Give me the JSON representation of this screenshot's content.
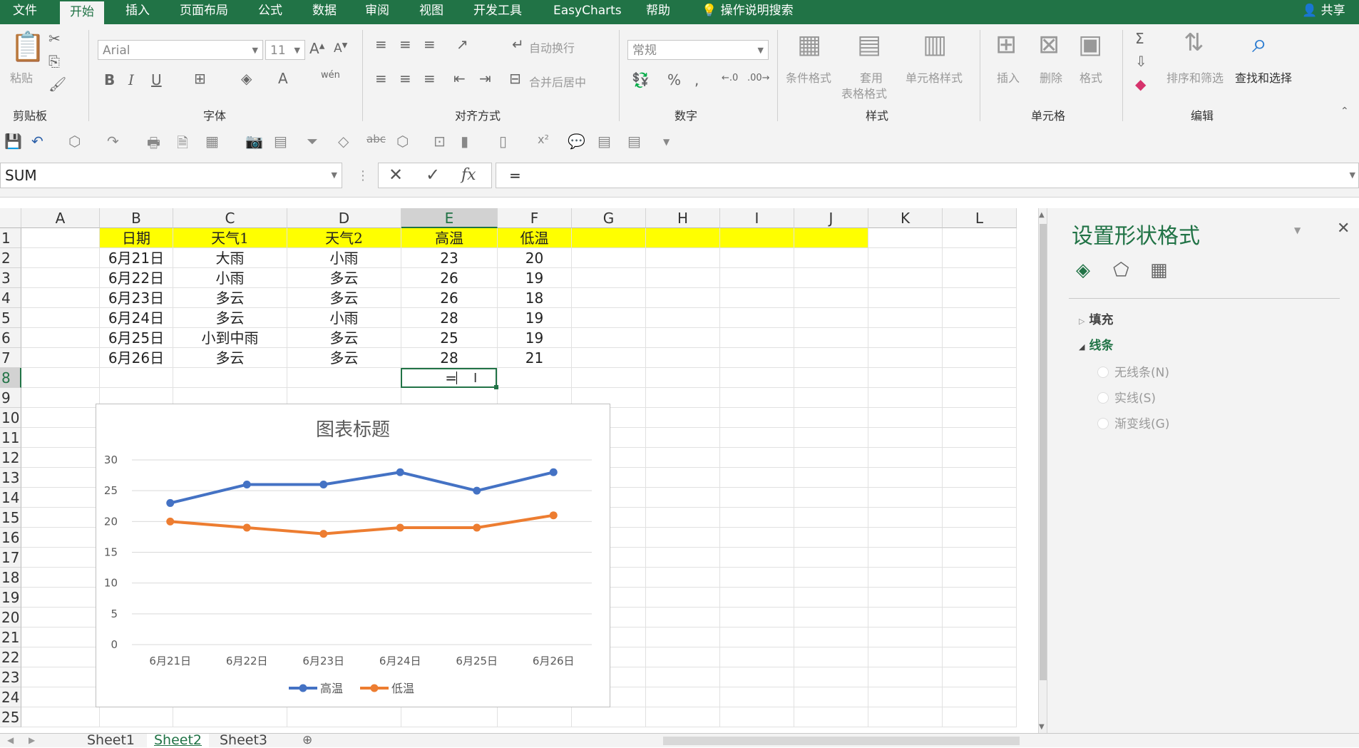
{
  "tabs": [
    "文件",
    "开始",
    "插入",
    "页面布局",
    "公式",
    "数据",
    "审阅",
    "视图",
    "开发工具",
    "EasyCharts",
    "帮助"
  ],
  "active_tab": "开始",
  "search_label": "操作说明搜索",
  "share_label": "共享",
  "ribbon": {
    "clipboard": {
      "paste": "粘贴",
      "group": "剪贴板"
    },
    "font": {
      "name": "Arial",
      "size": "11",
      "group": "字体",
      "phonetic": "wén"
    },
    "align": {
      "wrap": "自动换行",
      "merge": "合并后居中",
      "group": "对齐方式"
    },
    "number": {
      "format": "常规",
      "group": "数字"
    },
    "styles": {
      "cond": "条件格式",
      "table_1": "套用",
      "table_2": "表格格式",
      "cell": "单元格样式",
      "group": "样式"
    },
    "cells": {
      "insert": "插入",
      "delete": "删除",
      "format": "格式",
      "group": "单元格"
    },
    "edit": {
      "sort": "排序和筛选",
      "find": "查找和选择",
      "group": "编辑"
    }
  },
  "name_box": "SUM",
  "formula": "=",
  "columns": [
    "A",
    "B",
    "C",
    "D",
    "E",
    "F",
    "G",
    "H",
    "I",
    "J",
    "K",
    "L"
  ],
  "selected_column": "E",
  "rows": [
    "1",
    "2",
    "3",
    "4",
    "5",
    "6",
    "7",
    "8",
    "9",
    "10",
    "11",
    "12",
    "13",
    "14",
    "15",
    "16",
    "17",
    "18",
    "19",
    "20",
    "21",
    "22",
    "23",
    "24",
    "25"
  ],
  "selected_row": "8",
  "table": {
    "headers": [
      "日期",
      "天气1",
      "天气2",
      "高温",
      "低温"
    ],
    "data": [
      [
        "6月21日",
        "大雨",
        "小雨",
        "23",
        "20"
      ],
      [
        "6月22日",
        "小雨",
        "多云",
        "26",
        "19"
      ],
      [
        "6月23日",
        "多云",
        "多云",
        "26",
        "18"
      ],
      [
        "6月24日",
        "多云",
        "小雨",
        "28",
        "19"
      ],
      [
        "6月25日",
        "小到中雨",
        "多云",
        "25",
        "19"
      ],
      [
        "6月26日",
        "多云",
        "多云",
        "28",
        "21"
      ]
    ],
    "editing_value": "="
  },
  "header_fill": "#ffff00",
  "chart_data": {
    "type": "line",
    "title": "图表标题",
    "categories": [
      "6月21日",
      "6月22日",
      "6月23日",
      "6月24日",
      "6月25日",
      "6月26日"
    ],
    "series": [
      {
        "name": "高温",
        "values": [
          23,
          26,
          26,
          28,
          25,
          28
        ],
        "color": "#4472c4"
      },
      {
        "name": "低温",
        "values": [
          20,
          19,
          18,
          19,
          19,
          21
        ],
        "color": "#ed7d31"
      }
    ],
    "ylim": [
      0,
      30
    ],
    "yticks": [
      "0",
      "5",
      "10",
      "15",
      "20",
      "25",
      "30"
    ],
    "grid": true,
    "legend": "bottom"
  },
  "pane": {
    "title": "设置形状格式",
    "fill": "填充",
    "line": "线条",
    "options": [
      "无线条(N)",
      "实线(S)",
      "渐变线(G)"
    ]
  },
  "sheet_tabs": [
    "Sheet1",
    "Sheet2",
    "Sheet3"
  ],
  "active_sheet": "Sheet2"
}
